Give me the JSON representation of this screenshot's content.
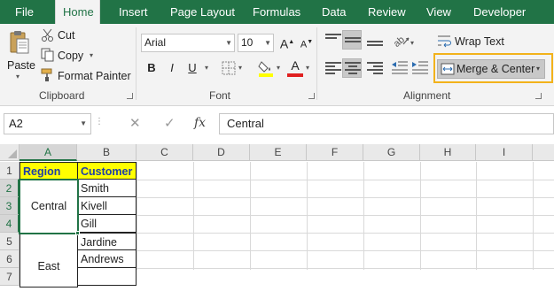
{
  "tabs": [
    "File",
    "Home",
    "Insert",
    "Page Layout",
    "Formulas",
    "Data",
    "Review",
    "View",
    "Developer"
  ],
  "active_tab": "Home",
  "clipboard": {
    "paste": "Paste",
    "cut": "Cut",
    "copy": "Copy",
    "format_painter": "Format Painter",
    "group_label": "Clipboard"
  },
  "font": {
    "name": "Arial",
    "size": "10",
    "bold": "B",
    "italic": "I",
    "underline": "U",
    "grow": "A",
    "shrink": "A",
    "font_color": "A",
    "group_label": "Font",
    "highlight_color": "#ffff00",
    "text_color": "#e02020"
  },
  "alignment": {
    "wrap_text": "Wrap Text",
    "merge_center": "Merge & Center",
    "group_label": "Alignment"
  },
  "formula_bar": {
    "name_box": "A2",
    "fx": "fx",
    "value": "Central"
  },
  "grid": {
    "columns": [
      "A",
      "B",
      "C",
      "D",
      "E",
      "F",
      "G",
      "H",
      "I"
    ],
    "rows": [
      "1",
      "2",
      "3",
      "4",
      "5",
      "6",
      "7"
    ],
    "header_row": [
      "Region",
      "Customer"
    ],
    "merged_a2_a4": "Central",
    "merged_a5_a7": "East",
    "customers": [
      "Smith",
      "Kivell",
      "Gill",
      "Jardine",
      "Andrews",
      ""
    ]
  },
  "colors": {
    "excel_green": "#217346",
    "header_fill": "#ffff00",
    "header_text": "#1f3ea6",
    "highlight_border": "#f2b21b"
  }
}
